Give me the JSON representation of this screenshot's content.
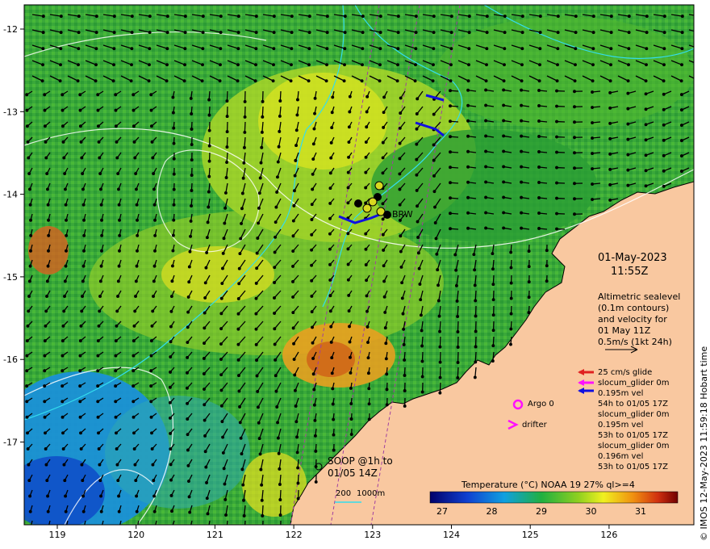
{
  "map": {
    "lon_ticks": [
      "119",
      "120",
      "121",
      "122",
      "123",
      "124",
      "125",
      "126"
    ],
    "lat_ticks": [
      "-12",
      "-13",
      "-14",
      "-15",
      "-16",
      "-17"
    ],
    "colors": {
      "land": "#f9c8a0",
      "sst_cool": "#2070e0",
      "sst_mid": "#2ea82e",
      "sst_warm": "#e8e020",
      "sst_hot": "#d83010",
      "contour_white": "#ffffff",
      "contour_cyan": "#33ddee",
      "track_purple": "#a040a0"
    }
  },
  "overlay": {
    "date": "01-May-2023",
    "time": "11:55Z",
    "altimetry_lines": [
      "Altimetric sealevel",
      "(0.1m contours)",
      "and velocity for",
      "01 May 11Z",
      "0.5m/s (1kt 24h)"
    ],
    "glider_legend": [
      "25 cm/s glide",
      "slocum_glider 0m",
      "0.195m vel",
      "54h to 01/05 17Z",
      "slocum_glider 0m",
      "0.195m vel",
      "53h to 01/05 17Z",
      "slocum_glider 0m",
      "0.196m vel",
      "53h to 01/05 17Z"
    ],
    "argo_label": "Argo 0",
    "drifter_label": "drifter",
    "soop_line1": "SOOP @1h to",
    "soop_line2": "01/05 14Z",
    "depth_200": "200",
    "depth_1000": "1000m",
    "station_label": "BRW",
    "colorbar_title": "Temperature (°C) NOAA 19 27% ql>=4",
    "colorbar_ticks": [
      "27",
      "28",
      "29",
      "30",
      "31"
    ],
    "credit": "© IMOS 12-May-2023 11:59:18 Hobart time"
  }
}
